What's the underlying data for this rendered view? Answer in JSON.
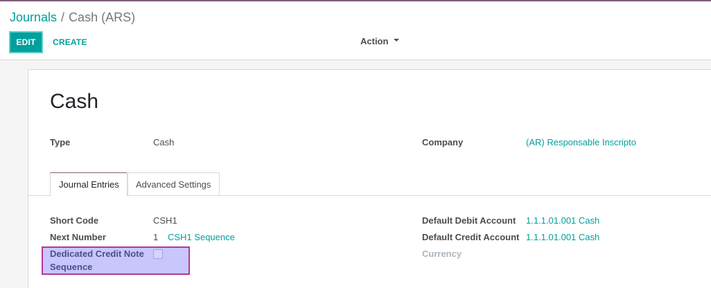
{
  "breadcrumb": {
    "parent": "Journals",
    "separator": "/",
    "current": "Cash (ARS)"
  },
  "toolbar": {
    "edit_label": "EDIT",
    "create_label": "CREATE",
    "action_label": "Action"
  },
  "record": {
    "title": "Cash",
    "fields": {
      "type_label": "Type",
      "type_value": "Cash",
      "company_label": "Company",
      "company_value": "(AR) Responsable Inscripto"
    }
  },
  "tabs": [
    {
      "label": "Journal Entries",
      "active": true
    },
    {
      "label": "Advanced Settings",
      "active": false
    }
  ],
  "journal_entries": {
    "short_code_label": "Short Code",
    "short_code_value": "CSH1",
    "next_number_label": "Next Number",
    "next_number_value": "1",
    "next_number_sequence": "CSH1 Sequence",
    "dedicated_credit_note_label_line1": "Dedicated Credit Note",
    "dedicated_credit_note_label_line2": "Sequence",
    "dedicated_credit_note_checked": false,
    "default_debit_label": "Default Debit Account",
    "default_debit_value": "1.1.1.01.001 Cash",
    "default_credit_label": "Default Credit Account",
    "default_credit_value": "1.1.1.01.001 Cash",
    "currency_label": "Currency",
    "currency_value": ""
  },
  "colors": {
    "brand_teal": "#00a09d",
    "highlight_fill": "#c9c6fb",
    "highlight_border": "#b5379a"
  }
}
